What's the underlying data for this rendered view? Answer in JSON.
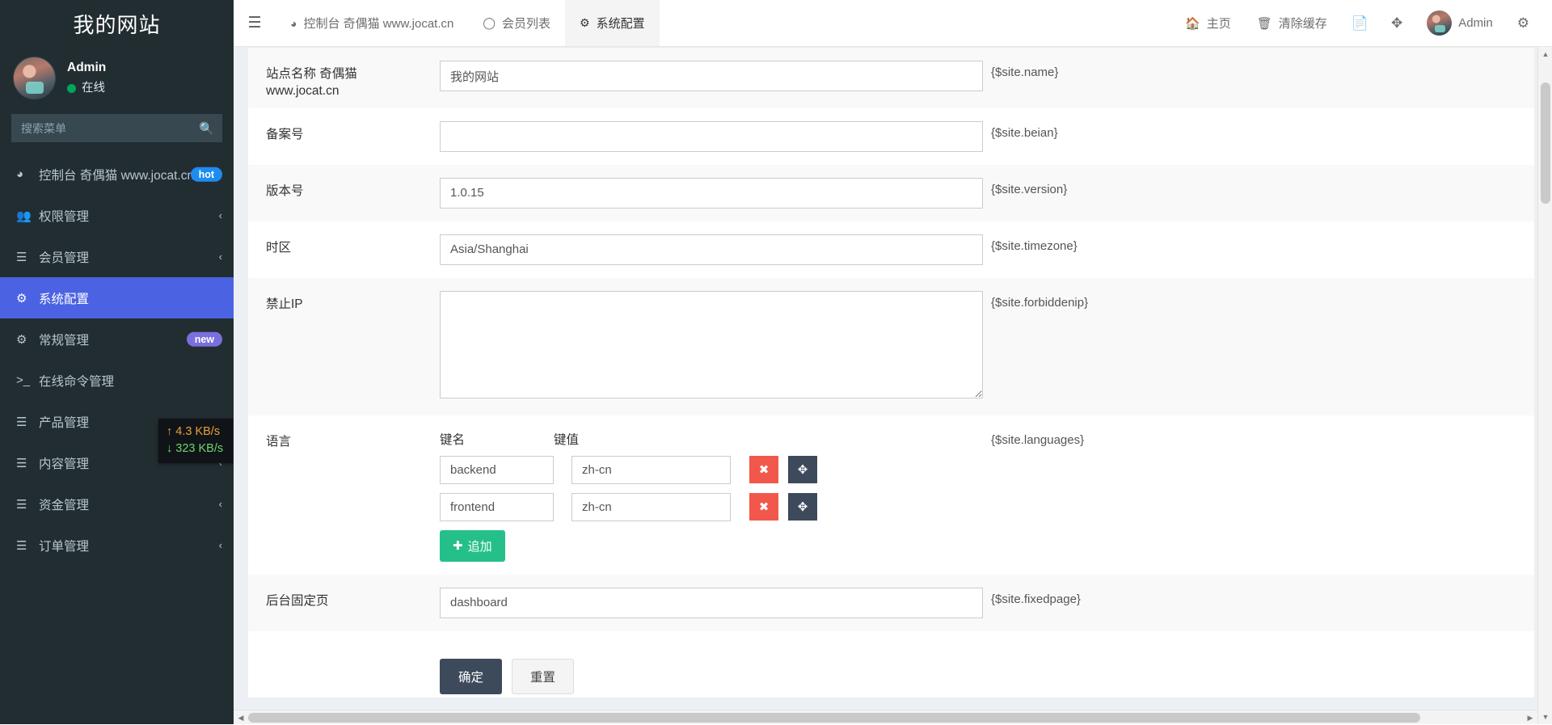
{
  "sidebar": {
    "brand": "我的网站",
    "user": {
      "name": "Admin",
      "status": "在线"
    },
    "search": {
      "value": "",
      "placeholder": "搜索菜单",
      "icon": "search-icon"
    },
    "items": [
      {
        "label": "控制台 奇偶猫 www.jocat.cn",
        "icon": "dashboard-icon",
        "badge": "hot",
        "badge_kind": "hot",
        "caret": "",
        "active": false
      },
      {
        "label": "权限管理",
        "icon": "users-icon",
        "badge": "",
        "badge_kind": "",
        "caret": "‹",
        "active": false
      },
      {
        "label": "会员管理",
        "icon": "list-icon",
        "badge": "",
        "badge_kind": "",
        "caret": "‹",
        "active": false
      },
      {
        "label": "系统配置",
        "icon": "gear-icon",
        "badge": "",
        "badge_kind": "",
        "caret": "",
        "active": true
      },
      {
        "label": "常规管理",
        "icon": "gears-icon",
        "badge": "new",
        "badge_kind": "new",
        "caret": "",
        "active": false
      },
      {
        "label": "在线命令管理",
        "icon": "terminal-icon",
        "badge": "",
        "badge_kind": "",
        "caret": "",
        "active": false
      },
      {
        "label": "产品管理",
        "icon": "list-icon",
        "badge": "",
        "badge_kind": "",
        "caret": "‹",
        "active": false
      },
      {
        "label": "内容管理",
        "icon": "list-icon",
        "badge": "",
        "badge_kind": "",
        "caret": "‹",
        "active": false
      },
      {
        "label": "资金管理",
        "icon": "list-icon",
        "badge": "",
        "badge_kind": "",
        "caret": "‹",
        "active": false
      },
      {
        "label": "订单管理",
        "icon": "list-icon",
        "badge": "",
        "badge_kind": "",
        "caret": "‹",
        "active": false
      }
    ]
  },
  "netspeed": {
    "upload": "4.3 KB/s",
    "download": "323 KB/s",
    "up_arrow": "↑",
    "down_arrow": "↓"
  },
  "header": {
    "menu_toggle_icon": "hamburger-icon",
    "tabs": [
      {
        "label": "控制台 奇偶猫 www.jocat.cn",
        "icon": "dashboard-icon",
        "active": false
      },
      {
        "label": "会员列表",
        "icon": "circle-icon",
        "active": false
      },
      {
        "label": "系统配置",
        "icon": "gear-icon",
        "active": true
      }
    ],
    "actions": [
      {
        "label": "主页",
        "icon": "home-icon"
      },
      {
        "label": "清除缓存",
        "icon": "trash-icon"
      }
    ],
    "icon_buttons": [
      {
        "icon": "copy-icon"
      },
      {
        "icon": "fullscreen-icon"
      }
    ],
    "user": {
      "label": "Admin",
      "avatar": "avatar"
    },
    "settings_icon": "gear-icon"
  },
  "form": {
    "rows": [
      {
        "label": "站点名称 奇偶猫 www.jocat.cn",
        "type": "text",
        "value": "我的网站",
        "placeholder": "",
        "var": "{$site.name}",
        "striped": true
      },
      {
        "label": "备案号",
        "type": "text",
        "value": "",
        "placeholder": "",
        "var": "{$site.beian}",
        "striped": false
      },
      {
        "label": "版本号",
        "type": "text",
        "value": "1.0.15",
        "placeholder": "",
        "var": "{$site.version}",
        "striped": true
      },
      {
        "label": "时区",
        "type": "text",
        "value": "Asia/Shanghai",
        "placeholder": "",
        "var": "{$site.timezone}",
        "striped": false
      },
      {
        "label": "禁止IP",
        "type": "textarea",
        "value": "",
        "placeholder": "",
        "var": "{$site.forbiddenip}",
        "striped": true
      },
      {
        "label": "语言",
        "type": "keyvalue",
        "value": "",
        "placeholder": "",
        "var": "{$site.languages}",
        "striped": false
      },
      {
        "label": "后台固定页",
        "type": "text",
        "value": "dashboard",
        "placeholder": "",
        "var": "{$site.fixedpage}",
        "striped": true
      }
    ],
    "keyvalue": {
      "head_key": "键名",
      "head_value": "键值",
      "rows": [
        {
          "key": "backend",
          "value": "zh-cn",
          "delete_icon": "times-icon",
          "move_icon": "arrows-icon"
        },
        {
          "key": "frontend",
          "value": "zh-cn",
          "delete_icon": "times-icon",
          "move_icon": "arrows-icon"
        }
      ],
      "add_label": "追加",
      "add_icon": "plus-icon"
    },
    "submit_label": "确定",
    "reset_label": "重置"
  },
  "colors": {
    "sidebar_bg": "#222d32",
    "active_menu": "#4b63e3",
    "hot_badge": "#1e8bf0",
    "new_badge": "#7b6fdd",
    "online_dot": "#00a65a",
    "delete_button": "#f1584b",
    "move_button": "#3d4a5c",
    "add_button": "#25c08a",
    "primary_button": "#3d4a5c",
    "content_bg": "#ecf0f5"
  }
}
